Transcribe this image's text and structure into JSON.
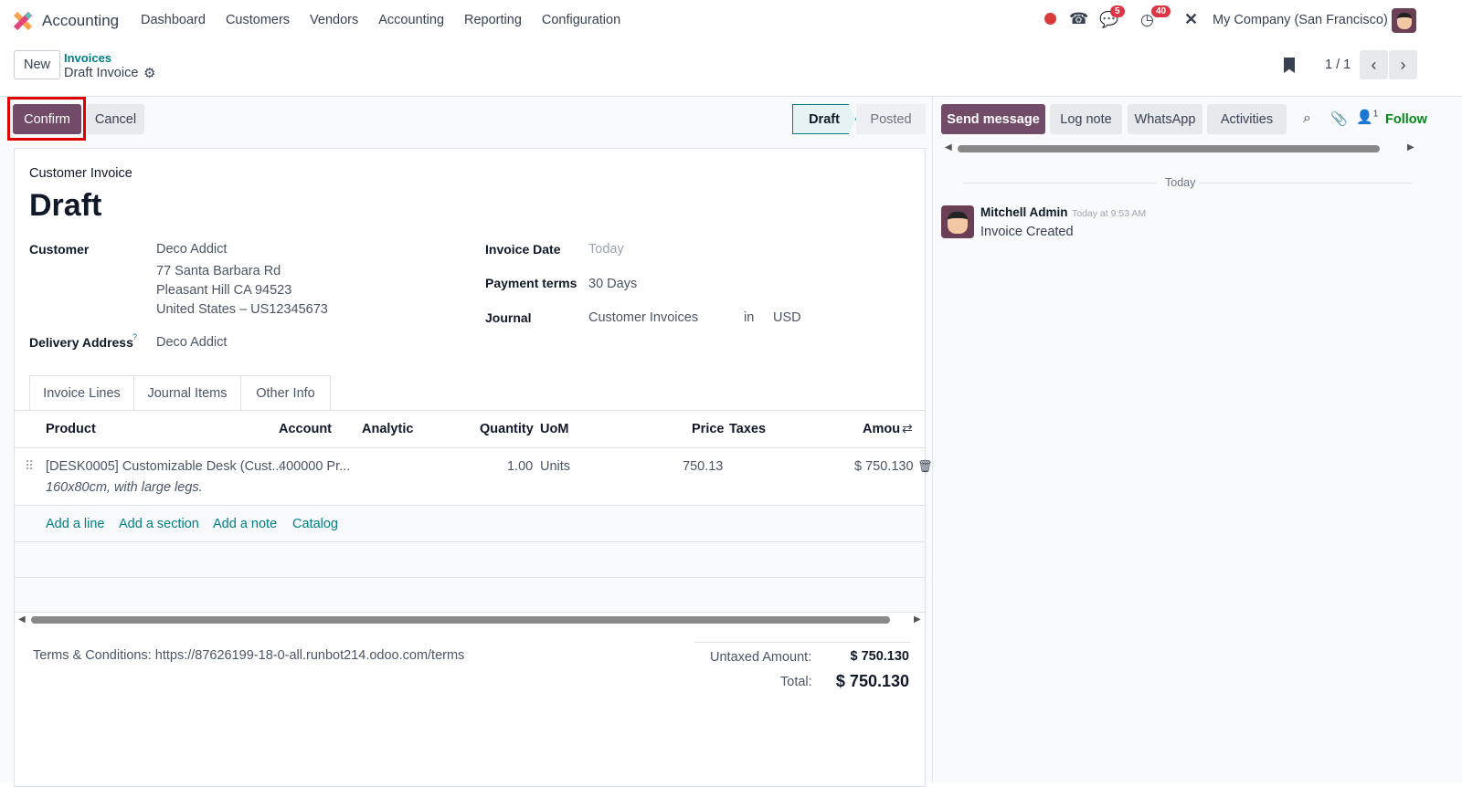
{
  "navbar": {
    "app_name": "Accounting",
    "menu": [
      "Dashboard",
      "Customers",
      "Vendors",
      "Accounting",
      "Reporting",
      "Configuration"
    ],
    "messages_count": "5",
    "activities_count": "40",
    "company": "My Company (San Francisco)"
  },
  "control": {
    "new_label": "New",
    "breadcrumb_parent": "Invoices",
    "breadcrumb_current": "Draft Invoice",
    "pager": "1 / 1"
  },
  "actions": {
    "confirm": "Confirm",
    "cancel": "Cancel",
    "status": [
      "Draft",
      "Posted"
    ],
    "active_status": "Draft"
  },
  "form": {
    "type_label": "Customer Invoice",
    "title": "Draft",
    "customer_label": "Customer",
    "customer_name": "Deco Addict",
    "address": [
      "77 Santa Barbara Rd",
      "Pleasant Hill CA 94523",
      "United States – US12345673"
    ],
    "delivery_label": "Delivery Address",
    "delivery_help": "?",
    "delivery_value": "Deco Addict",
    "invoice_date_label": "Invoice Date",
    "invoice_date_placeholder": "Today",
    "payment_terms_label": "Payment terms",
    "payment_terms": "30 Days",
    "journal_label": "Journal",
    "journal": "Customer Invoices",
    "journal_in": "in",
    "currency": "USD"
  },
  "tabs": [
    "Invoice Lines",
    "Journal Items",
    "Other Info"
  ],
  "table": {
    "headers": [
      "Product",
      "Account",
      "Analytic",
      "Quantity",
      "UoM",
      "Price",
      "Taxes",
      "Amou"
    ],
    "rows": [
      {
        "product": "[DESK0005] Customizable Desk (Cust...",
        "description": "160x80cm, with large legs.",
        "account": "400000 Pr...",
        "analytic": "",
        "quantity": "1.00",
        "uom": "Units",
        "price": "750.13",
        "taxes": "",
        "amount": "$ 750.130"
      }
    ],
    "add_links": [
      "Add a line",
      "Add a section",
      "Add a note",
      "Catalog"
    ]
  },
  "footer": {
    "terms": "Terms & Conditions: https://87626199-18-0-all.runbot214.odoo.com/terms",
    "untaxed_label": "Untaxed Amount:",
    "untaxed": "$ 750.130",
    "total_label": "Total:",
    "total": "$ 750.130"
  },
  "chatter": {
    "send_message": "Send message",
    "log_note": "Log note",
    "whatsapp": "WhatsApp",
    "activities": "Activities",
    "followers_count": "1",
    "follow": "Follow",
    "date_separator": "Today",
    "messages": [
      {
        "author": "Mitchell Admin",
        "time": "Today at 9:53 AM",
        "body": "Invoice Created"
      }
    ]
  },
  "colors": {
    "brand": "#714b67",
    "link": "#017e84",
    "badge": "#dc3545",
    "highlight": "#e00000"
  }
}
